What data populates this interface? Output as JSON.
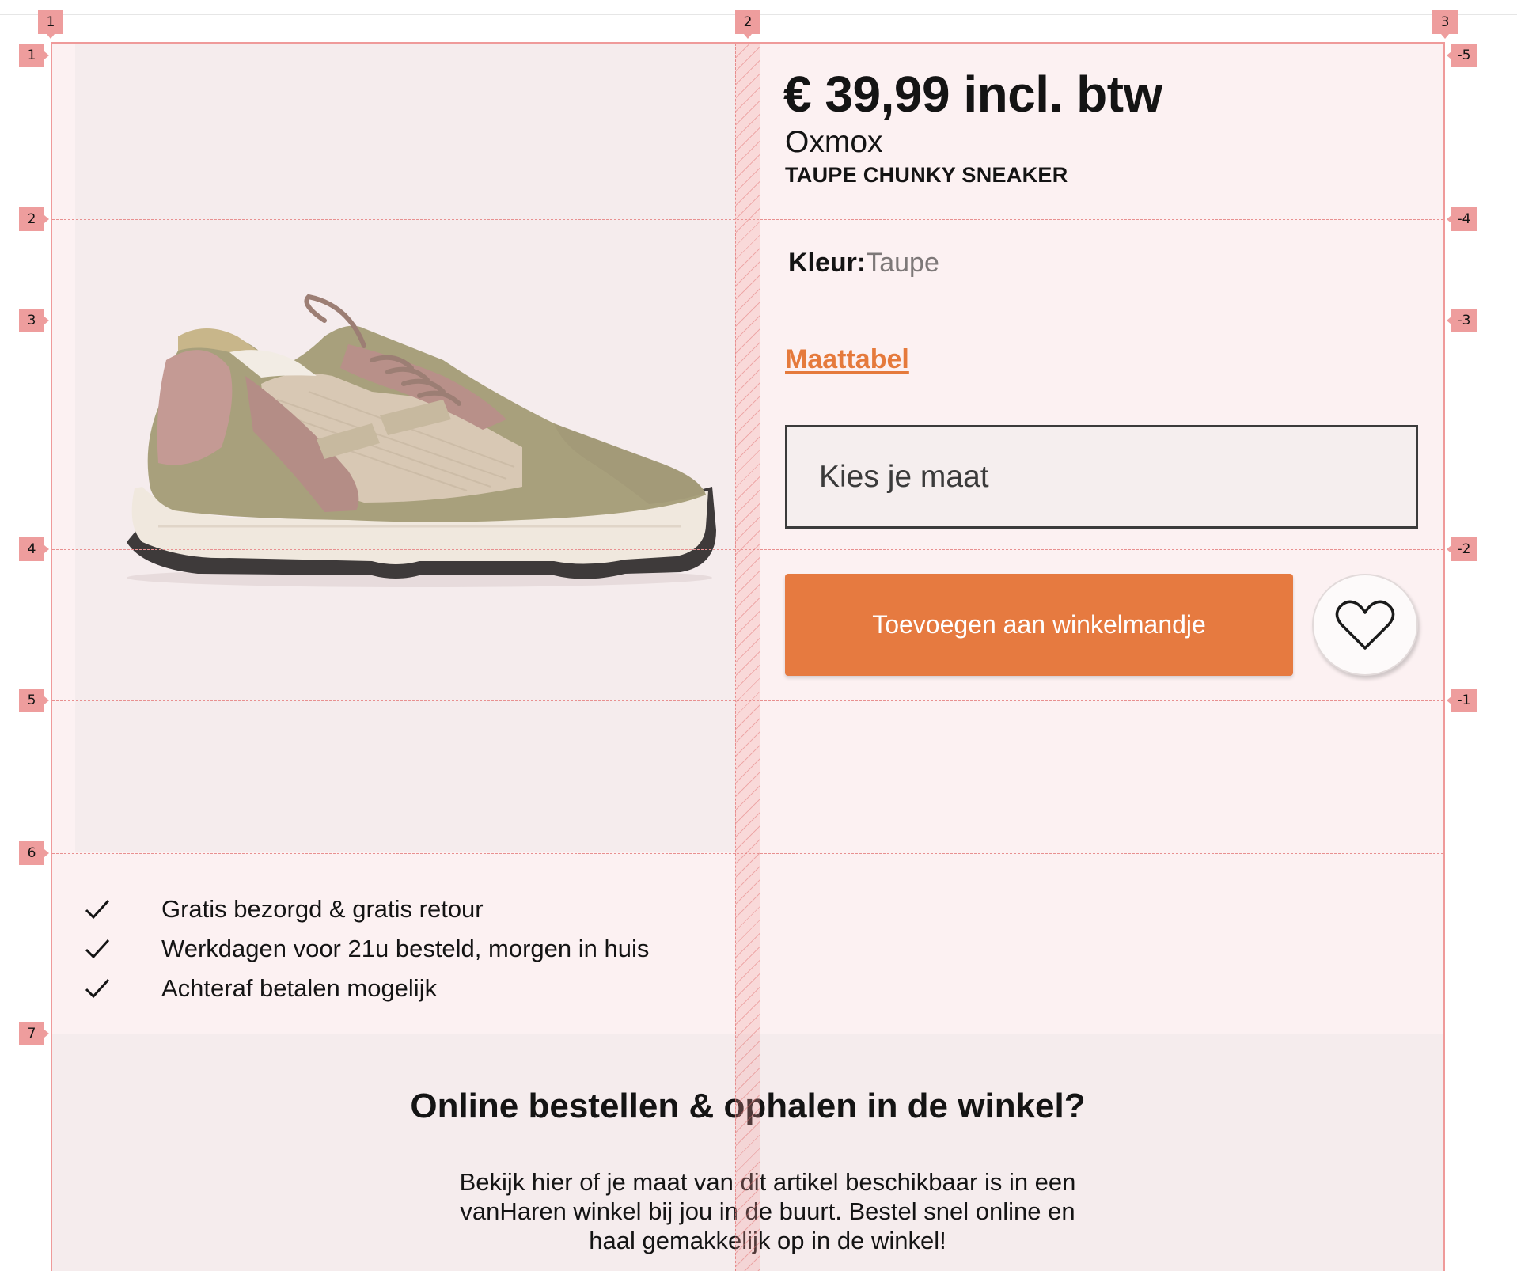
{
  "overlay": {
    "column_markers": [
      "1",
      "2",
      "3"
    ],
    "row_markers_left": [
      "1",
      "2",
      "3",
      "4",
      "5",
      "6",
      "7"
    ],
    "row_markers_right": [
      "-5",
      "-4",
      "-3",
      "-2",
      "-1"
    ]
  },
  "product": {
    "price": "€ 39,99 incl. btw",
    "brand": "Oxmox",
    "name": "TAUPE CHUNKY SNEAKER",
    "color_label": "Kleur:",
    "color_value": "Taupe",
    "size_chart_link": "Maattabel",
    "size_placeholder": "Kies je maat",
    "add_to_cart_label": "Toevoegen aan winkelmandje",
    "image_icon": "sneaker-image"
  },
  "usps": [
    {
      "icon": "check-icon",
      "text": "Gratis bezorgd & gratis retour"
    },
    {
      "icon": "check-icon",
      "text": "Werkdagen voor 21u besteld, morgen in huis"
    },
    {
      "icon": "check-icon",
      "text": "Achteraf betalen mogelijk"
    }
  ],
  "pickup": {
    "title": "Online bestellen & ophalen in de winkel?",
    "text": "Bekijk hier of je maat van dit artikel beschikbaar is in een vanHaren winkel bij jou in de buurt. Bestel snel online en haal gemakkelijk op in de winkel!"
  },
  "colors": {
    "accent": "#E67A40",
    "link": "#E57A3C",
    "text": "#141414",
    "muted": "#7D7878",
    "overlay": "#EE9D9D"
  },
  "icons": {
    "wishlist": "heart-icon",
    "usp": "check-icon"
  }
}
